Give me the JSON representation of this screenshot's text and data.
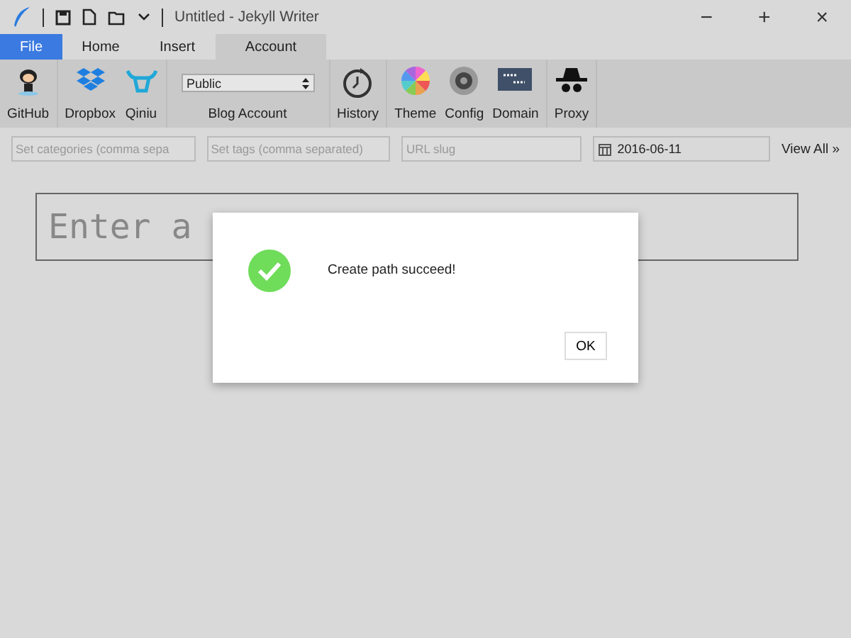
{
  "window": {
    "title": "Untitled - Jekyll Writer",
    "controls": [
      "−",
      "+",
      "×"
    ]
  },
  "tabs": [
    {
      "label": "File",
      "selected": false,
      "kind": "file"
    },
    {
      "label": "Home",
      "selected": false,
      "kind": "tab"
    },
    {
      "label": "Insert",
      "selected": false,
      "kind": "tab"
    },
    {
      "label": "Account",
      "selected": true,
      "kind": "tab"
    }
  ],
  "ribbon": [
    {
      "label": "GitHub",
      "kind": "github"
    },
    {
      "label": "Dropbox",
      "kind": "dropbox"
    },
    {
      "label": "Qiniu",
      "kind": "qiniu"
    },
    {
      "label": "Blog Account",
      "kind": "select",
      "value": "Public"
    },
    {
      "label": "History",
      "kind": "history"
    },
    {
      "label": "Theme",
      "kind": "theme"
    },
    {
      "label": "Config",
      "kind": "config"
    },
    {
      "label": "Domain",
      "kind": "domain"
    },
    {
      "label": "Proxy",
      "kind": "proxy"
    }
  ],
  "meta": {
    "categories_placeholder": "Set categories (comma sepa",
    "tags_placeholder": "Set tags (comma separated)",
    "slug_placeholder": "URL slug",
    "date": "2016-06-11",
    "view_all": "View All »"
  },
  "title_placeholder": "Enter a",
  "dialog": {
    "message": "Create path succeed!",
    "button": "OK"
  }
}
